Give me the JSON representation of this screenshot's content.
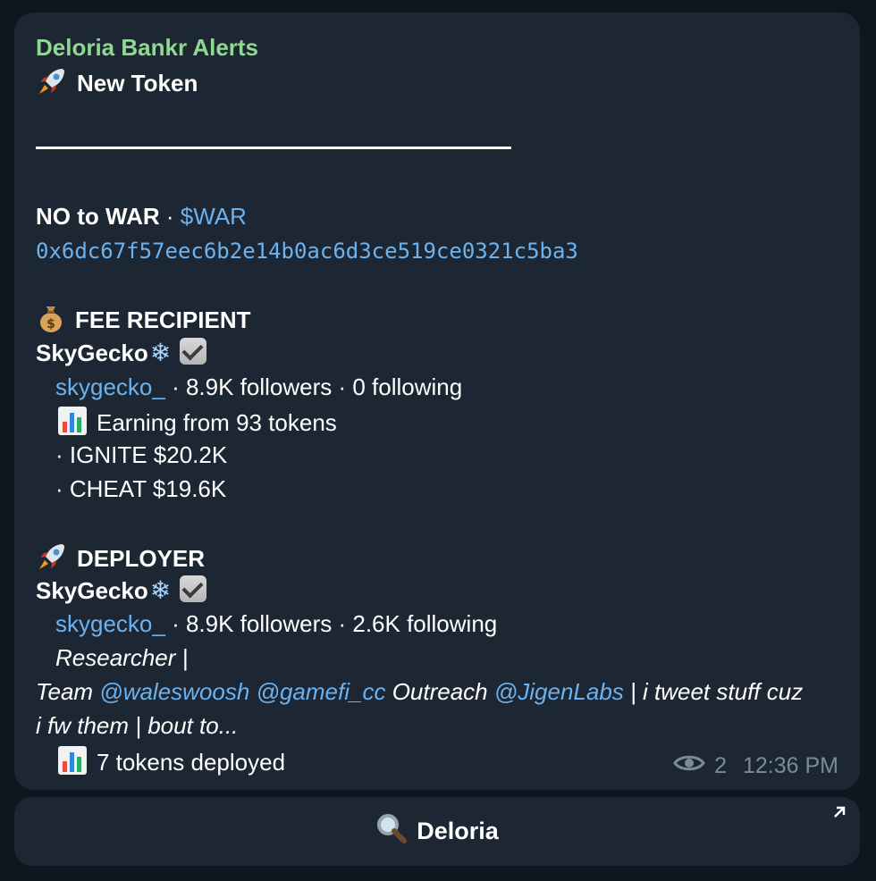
{
  "message": {
    "sender": "Deloria Bankr Alerts",
    "header": "New Token",
    "token_name": "NO to WAR",
    "separator": "·",
    "token_ticker": "$WAR",
    "contract": "0x6dc67f57eec6b2e14b0ac6d3ce519ce0321c5ba3",
    "fee_section": {
      "title": "FEE RECIPIENT",
      "name": "SkyGecko",
      "handle": "skygecko_",
      "stats": " · 8.9K followers · 0 following",
      "earning": "Earning from 93 tokens",
      "items": [
        "· IGNITE $20.2K",
        "· CHEAT $19.6K"
      ]
    },
    "deployer_section": {
      "title": "DEPLOYER",
      "name": "SkyGecko",
      "handle": "skygecko_",
      "stats": " · 8.9K followers · 2.6K following",
      "bio_line1": "Researcher |",
      "bio_team": "Team ",
      "mention1": "@waleswoosh",
      "mention2": "@gamefi_cc",
      "bio_mid": " Outreach ",
      "mention3": "@JigenLabs",
      "bio_tail": " | i tweet stuff cuz",
      "bio_line3": "i fw them | bout to...",
      "deployed": "7 tokens deployed"
    },
    "views": "2",
    "time": "12:36 PM"
  },
  "button": {
    "label": "Deloria",
    "icon": "magnifier-icon",
    "corner_icon": "external-arrow-icon"
  },
  "colors": {
    "background": "#0f1620",
    "bubble": "#1c2733",
    "link": "#6cb2ee",
    "sender": "#8fd88f",
    "meta": "#7b8a99"
  }
}
